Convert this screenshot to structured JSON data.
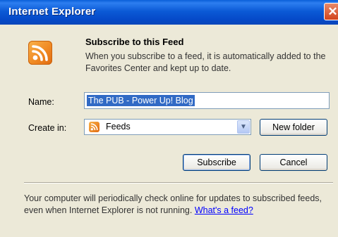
{
  "window": {
    "title": "Internet Explorer",
    "close_glyph": "✕"
  },
  "header": {
    "icon": "rss-feed-icon",
    "title": "Subscribe to this Feed",
    "description": "When you subscribe to a feed, it is automatically added to the Favorites Center and kept up to date."
  },
  "form": {
    "name_label": "Name:",
    "name_value": "The PUB - Power Up! Blog",
    "create_in_label": "Create in:",
    "create_in_value": "Feeds",
    "dropdown_arrow": "▼",
    "new_folder_label": "New folder"
  },
  "buttons": {
    "subscribe_label": "Subscribe",
    "cancel_label": "Cancel"
  },
  "footer": {
    "text": "Your computer will periodically check online for updates to subscribed feeds, even when Internet Explorer is not running. ",
    "link_label": "What's a feed?"
  },
  "colors": {
    "accent": "#316ac5",
    "link": "#0000ff",
    "dialog_bg": "#ece9d8"
  }
}
